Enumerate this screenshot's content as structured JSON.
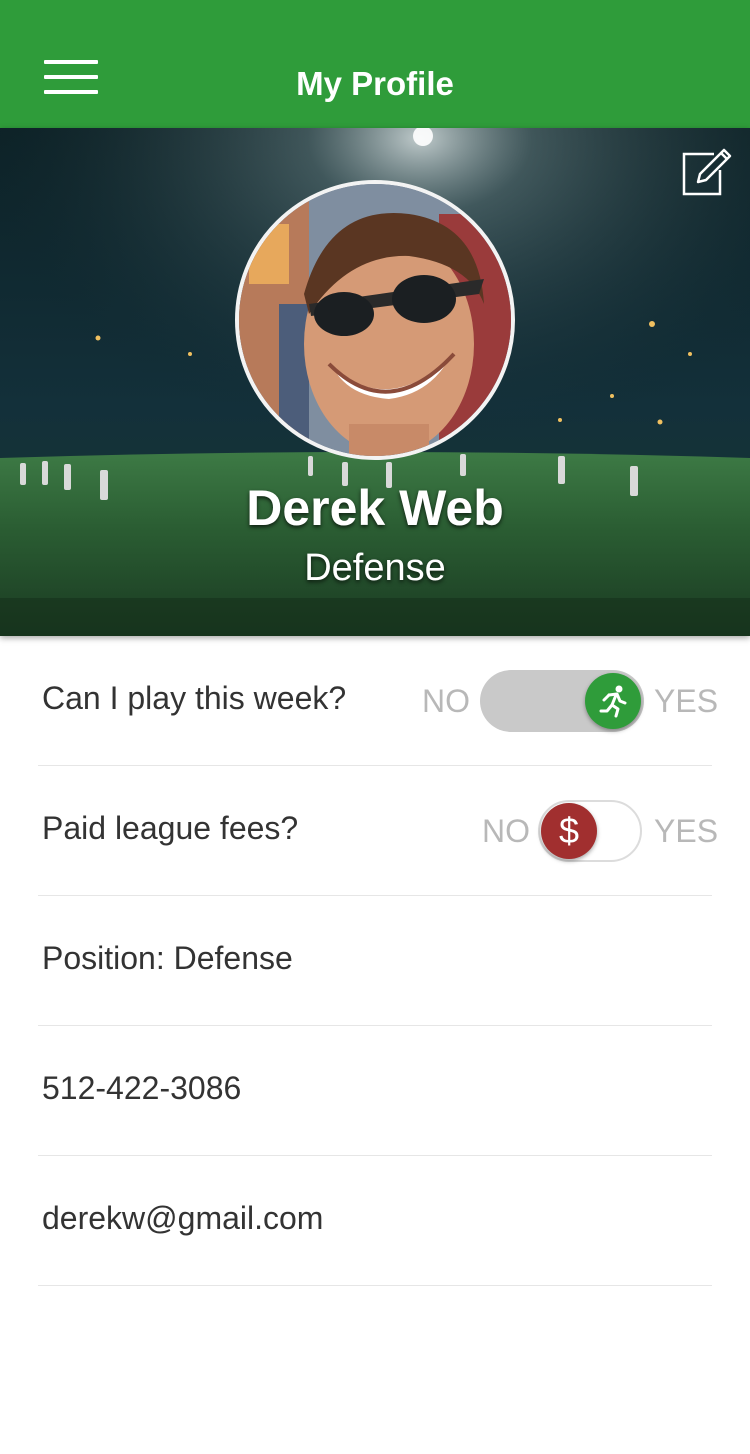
{
  "header": {
    "title": "My Profile",
    "menu_icon": "hamburger-menu-icon",
    "background": "#2f9c3a"
  },
  "hero": {
    "edit_icon": "edit-icon",
    "name": "Derek Web",
    "position": "Defense"
  },
  "settings": [
    {
      "label": "Can I play this week?",
      "no_label": "NO",
      "yes_label": "YES",
      "value": true,
      "knob_icon": "running-person-icon",
      "knob_color": "#2f9c3a"
    },
    {
      "label": "Paid league fees?",
      "no_label": "NO",
      "yes_label": "YES",
      "value": false,
      "knob_icon": "dollar-icon",
      "knob_symbol": "$",
      "knob_color": "#a12f2f"
    }
  ],
  "info": {
    "position": "Position: Defense",
    "phone": "512-422-3086",
    "email": "derekw@gmail.com"
  }
}
